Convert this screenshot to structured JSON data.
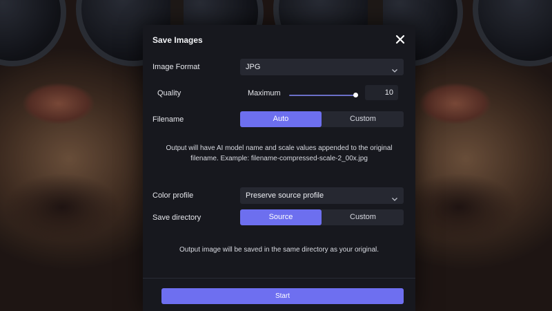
{
  "dialog": {
    "title": "Save Images",
    "close_icon": "close-icon"
  },
  "image_format": {
    "label": "Image Format",
    "value": "JPG"
  },
  "quality": {
    "label": "Quality",
    "preset": "Maximum",
    "value": "10",
    "slider_fraction": 1.0
  },
  "filename": {
    "label": "Filename",
    "options": [
      "Auto",
      "Custom"
    ],
    "selected": "Auto",
    "note": "Output will have AI model name and scale values appended to the original filename. Example: filename-compressed-scale-2_00x.jpg"
  },
  "color_profile": {
    "label": "Color profile",
    "value": "Preserve source profile"
  },
  "save_directory": {
    "label": "Save directory",
    "options": [
      "Source",
      "Custom"
    ],
    "selected": "Source",
    "note": "Output image will be saved in the same directory as your original."
  },
  "start_button": "Start",
  "colors": {
    "accent": "#6d6fef",
    "dialog_bg": "#17181e",
    "control_bg": "#262831"
  }
}
